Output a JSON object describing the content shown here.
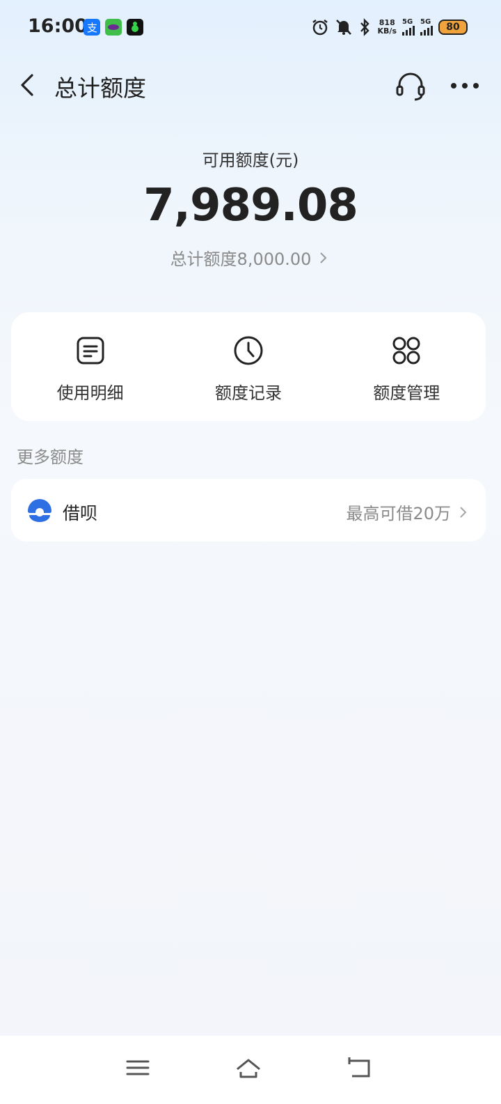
{
  "status_bar": {
    "time": "16:00",
    "net_speed_value": "818",
    "net_speed_unit": "KB/s",
    "signal1_label": "5G",
    "signal2_label": "5G",
    "battery": "80",
    "icons": [
      "alipay-icon",
      "app-icon-2",
      "app-icon-3",
      "alarm-icon",
      "mute-icon",
      "bluetooth-icon"
    ]
  },
  "header": {
    "title": "总计额度"
  },
  "summary": {
    "available_label": "可用额度(元)",
    "available_amount": "7,989.08",
    "total_text": "总计额度8,000.00"
  },
  "actions": [
    {
      "label": "使用明细",
      "icon": "document-icon"
    },
    {
      "label": "额度记录",
      "icon": "clock-icon"
    },
    {
      "label": "额度管理",
      "icon": "grid-icon"
    }
  ],
  "more_section": {
    "title": "更多额度",
    "item": {
      "label": "借呗",
      "detail": "最高可借20万",
      "icon": "jiebei-icon"
    }
  },
  "colors": {
    "accent": "#2f6fe4",
    "battery": "#f0a33c"
  }
}
